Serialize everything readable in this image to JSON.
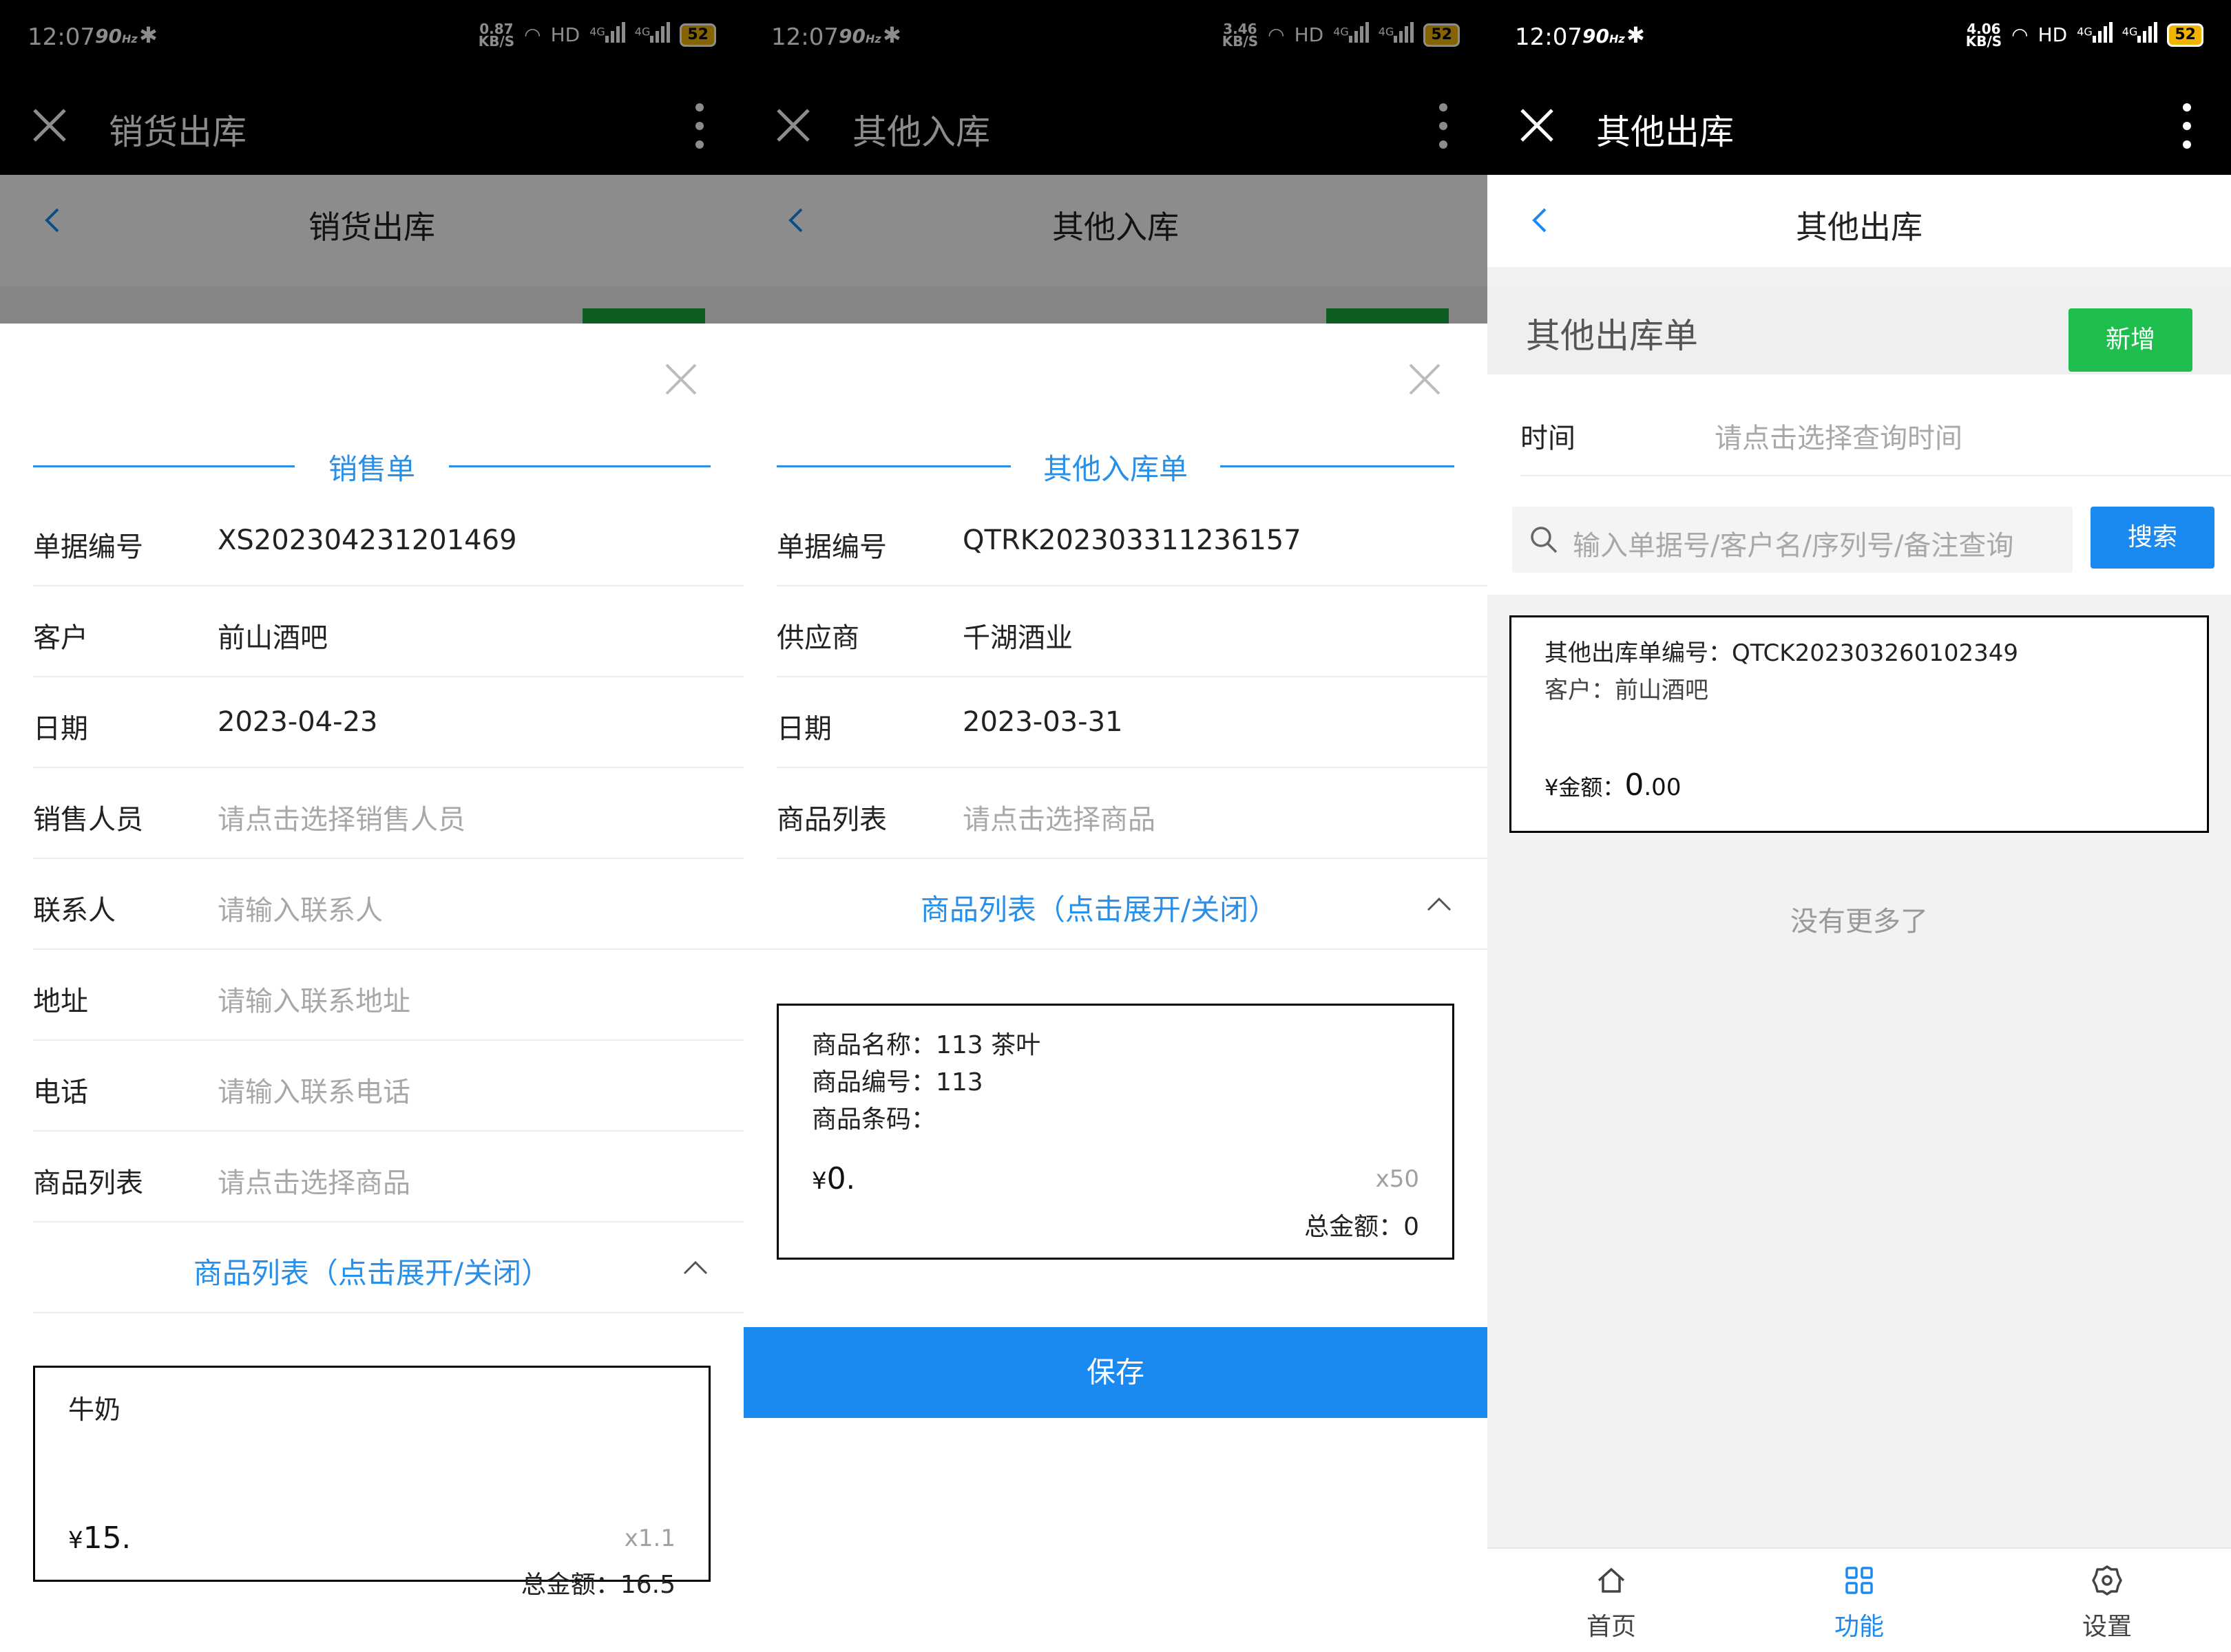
{
  "status": {
    "time": "12:07",
    "hz": "90",
    "hz_unit": "Hz",
    "speeds": [
      "0.87",
      "3.46",
      "4.06"
    ],
    "kbs": "KB/S",
    "hd": "HD",
    "net": "4G",
    "battery": "52"
  },
  "screen1": {
    "window_title": "销货出库",
    "nav_title": "销货出库",
    "sheet": {
      "heading": "销售单",
      "rows": [
        {
          "label": "单据编号",
          "value": "XS202304231201469",
          "placeholder": false
        },
        {
          "label": "客户",
          "value": "前山酒吧",
          "placeholder": false
        },
        {
          "label": "日期",
          "value": "2023-04-23",
          "placeholder": false
        },
        {
          "label": "销售人员",
          "value": "请点击选择销售人员",
          "placeholder": true
        },
        {
          "label": "联系人",
          "value": "请输入联系人",
          "placeholder": true
        },
        {
          "label": "地址",
          "value": "请输入联系地址",
          "placeholder": true
        },
        {
          "label": "电话",
          "value": "请输入联系电话",
          "placeholder": true
        },
        {
          "label": "商品列表",
          "value": "请点击选择商品",
          "placeholder": true
        }
      ],
      "expand_label": "商品列表（点击展开/关闭）",
      "item": {
        "name": "牛奶",
        "price_prefix": "¥",
        "price_int": "15",
        "price_suffix": ".",
        "qty": "x1.1",
        "total": "总金额：16.5"
      }
    }
  },
  "screen2": {
    "window_title": "其他入库",
    "nav_title": "其他入库",
    "sheet": {
      "heading": "其他入库单",
      "rows": [
        {
          "label": "单据编号",
          "value": "QTRK202303311236157",
          "placeholder": false
        },
        {
          "label": "供应商",
          "value": "千湖酒业",
          "placeholder": false
        },
        {
          "label": "日期",
          "value": "2023-03-31",
          "placeholder": false
        },
        {
          "label": "商品列表",
          "value": "请点击选择商品",
          "placeholder": true
        }
      ],
      "expand_label": "商品列表（点击展开/关闭）",
      "item": {
        "lines": [
          "商品名称：113 茶叶",
          "商品编号：113",
          "商品条码："
        ],
        "price_prefix": "¥",
        "price_int": "0",
        "price_suffix": ".",
        "qty": "x50",
        "total": "总金额：0"
      },
      "save_label": "保存"
    }
  },
  "screen3": {
    "window_title": "其他出库",
    "nav_title": "其他出库",
    "list_title": "其他出库单",
    "add_label": "新增",
    "time_label": "时间",
    "time_placeholder": "请点击选择查询时间",
    "search_placeholder": "输入单据号/客户名/序列号/备注查询",
    "search_label": "搜索",
    "order": {
      "number": "其他出库单编号：QTCK202303260102349",
      "customer": "客户：前山酒吧",
      "amount_prefix": "¥金额：",
      "amount_int": "0",
      "amount_dec": ".00"
    },
    "no_more": "没有更多了",
    "tabs": [
      {
        "label": "首页",
        "icon": "home-icon",
        "active": false
      },
      {
        "label": "功能",
        "icon": "grid-icon",
        "active": true
      },
      {
        "label": "设置",
        "icon": "gear-icon",
        "active": false
      }
    ]
  },
  "colors": {
    "accent_blue": "#1b8af0",
    "heading_blue": "#2a8fe6",
    "add_green": "#1dbe4e"
  }
}
